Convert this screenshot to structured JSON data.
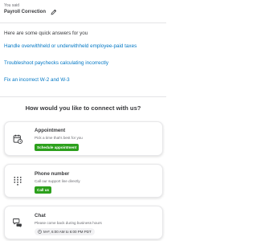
{
  "user_query": {
    "label": "You said",
    "text": "Payroll Correction",
    "edit_icon": "pencil-icon"
  },
  "quick_answers": {
    "title": "Here are some quick answers for you",
    "items": [
      "Handle overwithheld or underwithheld employee-paid taxes",
      "Troubleshoot paychecks calculating incorrectly",
      "Fix an incorrect W-2 and W-3"
    ]
  },
  "connect": {
    "title": "How would you like to connect with us?",
    "options": [
      {
        "icon": "calendar-icon",
        "title": "Appointment",
        "subtitle": "Pick a time that's best for you",
        "button": "Schedule appointment"
      },
      {
        "icon": "dialpad-icon",
        "title": "Phone number",
        "subtitle": "Call our support line directly",
        "button": "Call us"
      },
      {
        "icon": "chat-icon",
        "title": "Chat",
        "subtitle": "Please come back during business hours",
        "hours_icon": "clock-icon",
        "hours": "M-F, 6:00 AM to 6:00 PM PDT"
      }
    ]
  },
  "colors": {
    "link": "#0077c5",
    "accent_green": "#2ca01c",
    "text": "#393a3d",
    "muted": "#6b6c72"
  }
}
